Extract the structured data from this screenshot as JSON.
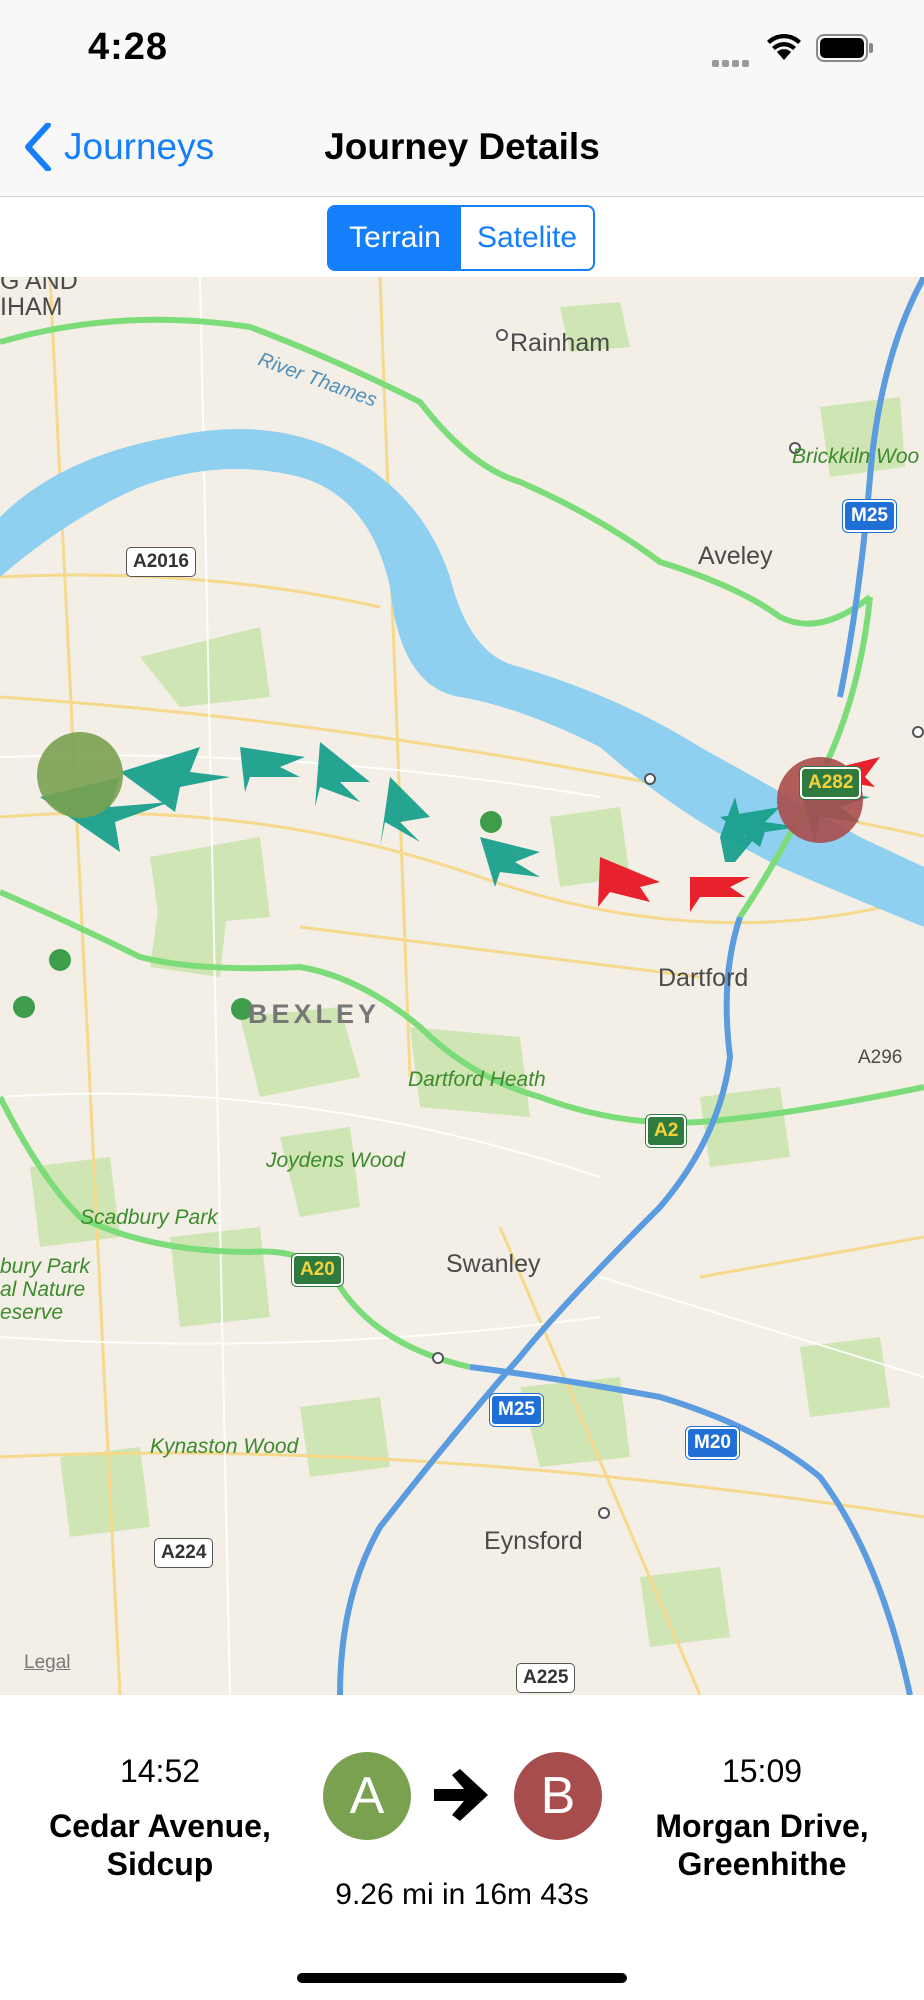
{
  "status_bar": {
    "time": "4:28"
  },
  "nav": {
    "back_label": "Journeys",
    "title": "Journey Details"
  },
  "map_type": {
    "options": [
      "Terrain",
      "Satelite"
    ],
    "selected": "Terrain"
  },
  "map": {
    "places": [
      "Rainham",
      "Aveley",
      "Dartford",
      "Swanley",
      "Eynsford"
    ],
    "district": "BEXLEY",
    "parks": [
      "Brickkiln Woo",
      "Dartford Heath",
      "Joydens Wood",
      "Scadbury Park",
      "bury Park",
      "al Nature",
      "eserve",
      "Kynaston Wood"
    ],
    "edge_labels": [
      "G AND",
      "IHAM"
    ],
    "river": "River Thames",
    "roads": [
      "A2016",
      "M25",
      "A282",
      "A296",
      "A2",
      "A20",
      "M25",
      "M20",
      "A224",
      "A225"
    ],
    "legal": "Legal",
    "start_marker": "A",
    "end_marker": "B"
  },
  "journey": {
    "start": {
      "time": "14:52",
      "place": "Cedar Avenue, Sidcup",
      "marker": "A"
    },
    "end": {
      "time": "15:09",
      "place": "Morgan Drive, Greenhithe",
      "marker": "B"
    },
    "summary": "9.26 mi in  16m 43s"
  },
  "colors": {
    "accent": "#147efb",
    "start_marker": "#7aa150",
    "end_marker": "#a84d4d",
    "route_arrow": "#1aa08e",
    "route_alert": "#e8222c"
  }
}
